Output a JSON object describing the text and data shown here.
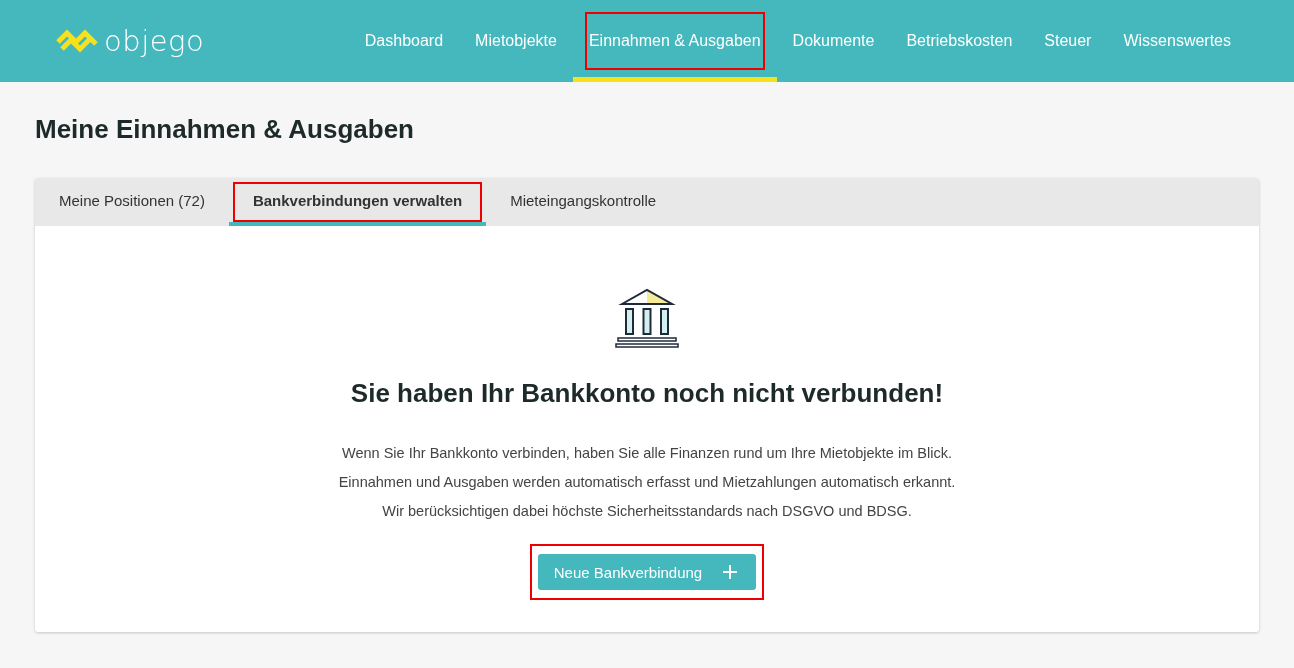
{
  "header": {
    "logo": "objego",
    "nav": [
      {
        "label": "Dashboard",
        "selected": false,
        "highlighted": false
      },
      {
        "label": "Mietobjekte",
        "selected": false,
        "highlighted": false
      },
      {
        "label": "Einnahmen & Ausgaben",
        "selected": true,
        "highlighted": true
      },
      {
        "label": "Dokumente",
        "selected": false,
        "highlighted": false
      },
      {
        "label": "Betriebskosten",
        "selected": false,
        "highlighted": false
      },
      {
        "label": "Steuer",
        "selected": false,
        "highlighted": false
      },
      {
        "label": "Wissenswertes",
        "selected": false,
        "highlighted": false
      }
    ]
  },
  "page_title": "Meine Einnahmen & Ausgaben",
  "tabs": [
    {
      "label": "Meine Positionen (72)",
      "selected": false,
      "highlighted": false
    },
    {
      "label": "Bankverbindungen verwalten",
      "selected": true,
      "highlighted": true
    },
    {
      "label": "Mieteingangskontrolle",
      "selected": false,
      "highlighted": false
    }
  ],
  "empty_state": {
    "heading": "Sie haben Ihr Bankkonto noch nicht verbunden!",
    "lines": [
      "Wenn Sie Ihr Bankkonto verbinden, haben Sie alle Finanzen rund um Ihre Mietobjekte im Blick.",
      "Einnahmen und Ausgaben werden automatisch erfasst und Mietzahlungen automatisch erkannt.",
      "Wir berücksichtigen dabei höchste Sicherheitsstandards nach DSGVO und BDSG."
    ],
    "button": {
      "label": "Neue Bankverbindung",
      "highlighted": true
    }
  }
}
